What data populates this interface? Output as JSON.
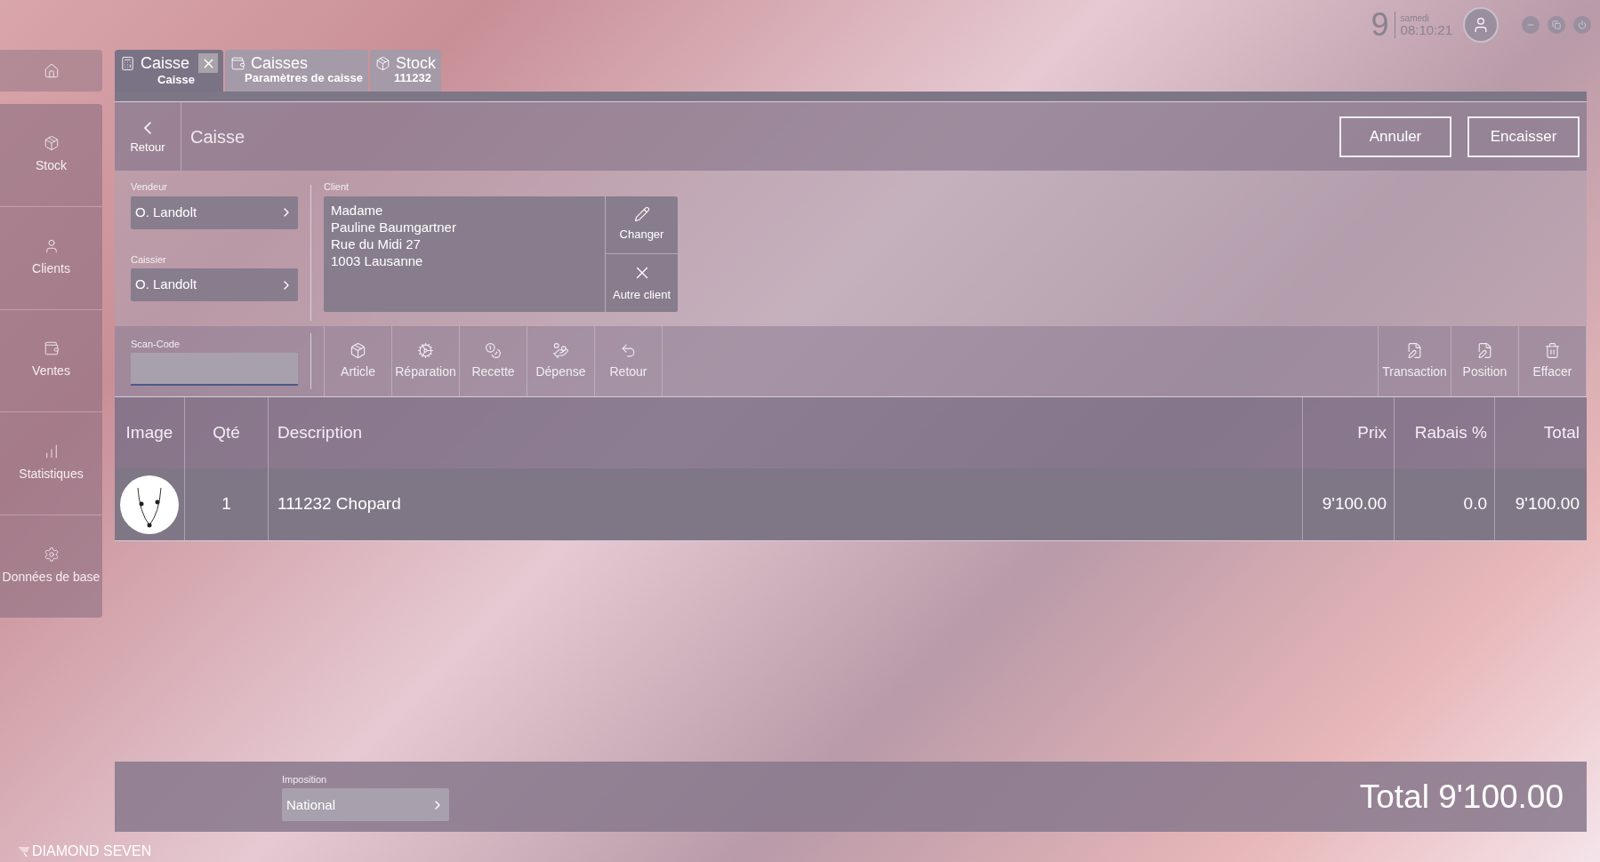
{
  "clock": {
    "day": "9",
    "weekday": "samedi",
    "time": "08:10:21"
  },
  "sidebar": {
    "items": [
      {
        "label": "Stock"
      },
      {
        "label": "Clients"
      },
      {
        "label": "Ventes"
      },
      {
        "label": "Statistiques"
      },
      {
        "label": "Données de base"
      }
    ]
  },
  "tabs": [
    {
      "title": "Caisse",
      "subtitle": "Caisse",
      "selected": true,
      "closable": true
    },
    {
      "title": "Caisses",
      "subtitle": "Paramètres de caisse",
      "selected": false,
      "closable": false
    },
    {
      "title": "Stock",
      "subtitle": "111232",
      "selected": false,
      "closable": false
    }
  ],
  "header": {
    "back_label": "Retour",
    "title": "Caisse",
    "actions": [
      "Annuler",
      "Encaisser"
    ]
  },
  "staff": [
    {
      "label": "Vendeur",
      "value": "O. Landolt"
    },
    {
      "label": "Caissier",
      "value": "O. Landolt"
    }
  ],
  "client": {
    "label": "Client",
    "address_lines": [
      "Madame",
      "Pauline Baumgartner",
      "Rue du Midi 27",
      "1003 Lausanne"
    ],
    "actions": [
      "Changer",
      "Autre client"
    ]
  },
  "scan_code": {
    "label": "Scan-Code"
  },
  "toolbar": {
    "left": [
      "Article",
      "Réparation",
      "Recette",
      "Dépense",
      "Retour"
    ],
    "right": [
      "Transaction",
      "Position",
      "Effacer"
    ]
  },
  "table": {
    "columns": [
      "Image",
      "Qté",
      "Description",
      "Prix",
      "Rabais %",
      "Total"
    ],
    "rows": [
      {
        "qty": "1",
        "description": "111232 Chopard",
        "price": "9'100.00",
        "discount": "0.0",
        "total": "9'100.00"
      }
    ]
  },
  "footer": {
    "imposition_label": "Imposition",
    "imposition_value": "National",
    "total": "Total 9'100.00"
  },
  "logo": "DIAMOND SEVEN"
}
